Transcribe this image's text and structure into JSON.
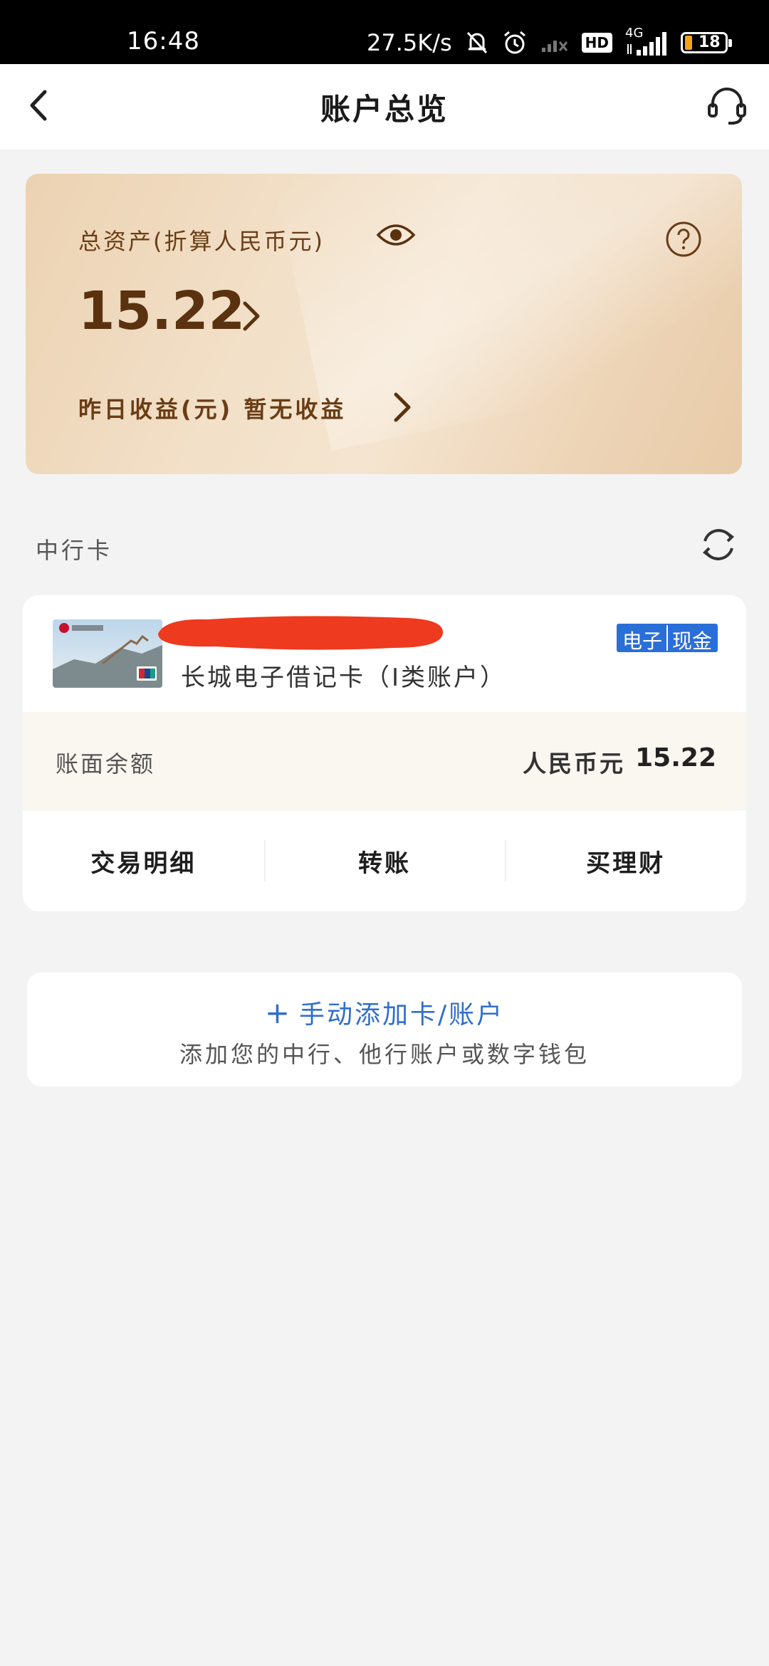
{
  "status_bar": {
    "time": "16:48",
    "network_speed": "27.5K/s",
    "network_type": "4G",
    "hd_label": "HD",
    "battery_level": "18"
  },
  "nav": {
    "title": "账户总览"
  },
  "assets": {
    "label": "总资产(折算人民币元)",
    "amount": "15.22",
    "yesterday_label": "昨日收益(元) 暂无收益"
  },
  "section": {
    "title": "中行卡"
  },
  "card": {
    "name": "长城电子借记卡（Ⅰ类账户）",
    "badge_a": "电子",
    "badge_b": "现金",
    "balance_label": "账面余额",
    "currency": "人民币元",
    "balance": "15.22",
    "actions": [
      "交易明细",
      "转账",
      "买理财"
    ]
  },
  "add_account": {
    "title": "手动添加卡/账户",
    "plus": "+",
    "subtitle": "添加您的中行、他行账户或数字钱包"
  },
  "colors": {
    "accent_blue": "#2f6fcb",
    "gold_text": "#5a3210",
    "redaction": "#ee3a1e"
  }
}
